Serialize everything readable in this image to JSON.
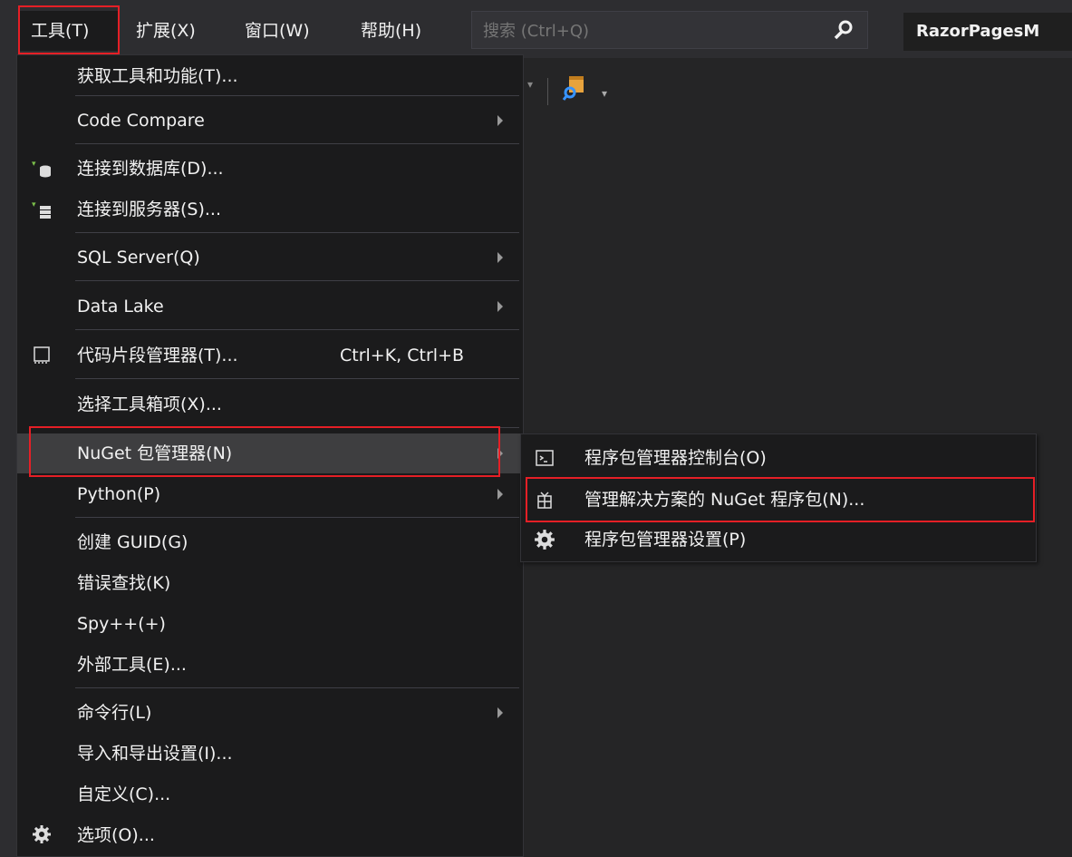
{
  "menubar": {
    "tools": "工具(T)",
    "extensions": "扩展(X)",
    "window": "窗口(W)",
    "help": "帮助(H)",
    "search_placeholder": "搜索 (Ctrl+Q)",
    "title": "RazorPagesM"
  },
  "tools_menu": {
    "items": [
      {
        "label": "获取工具和功能(T)..."
      },
      {
        "label": "Code Compare"
      },
      {
        "label": "连接到数据库(D)..."
      },
      {
        "label": "连接到服务器(S)..."
      },
      {
        "label": "SQL Server(Q)"
      },
      {
        "label": "Data Lake"
      },
      {
        "label": "代码片段管理器(T)...",
        "shortcut": "Ctrl+K, Ctrl+B"
      },
      {
        "label": "选择工具箱项(X)..."
      },
      {
        "label": "NuGet 包管理器(N)"
      },
      {
        "label": "Python(P)"
      },
      {
        "label": "创建 GUID(G)"
      },
      {
        "label": "错误查找(K)"
      },
      {
        "label": "Spy++(+)"
      },
      {
        "label": "外部工具(E)..."
      },
      {
        "label": "命令行(L)"
      },
      {
        "label": "导入和导出设置(I)..."
      },
      {
        "label": "自定义(C)..."
      },
      {
        "label": "选项(O)..."
      }
    ]
  },
  "nuget_submenu": {
    "items": [
      {
        "label": "程序包管理器控制台(O)"
      },
      {
        "label": "管理解决方案的 NuGet 程序包(N)..."
      },
      {
        "label": "程序包管理器设置(P)"
      }
    ]
  },
  "colors": {
    "menu_bg": "#1b1b1c",
    "menubar_bg": "#2d2d30",
    "highlight": "#3e3e40",
    "annotation_red": "#e51f26"
  }
}
